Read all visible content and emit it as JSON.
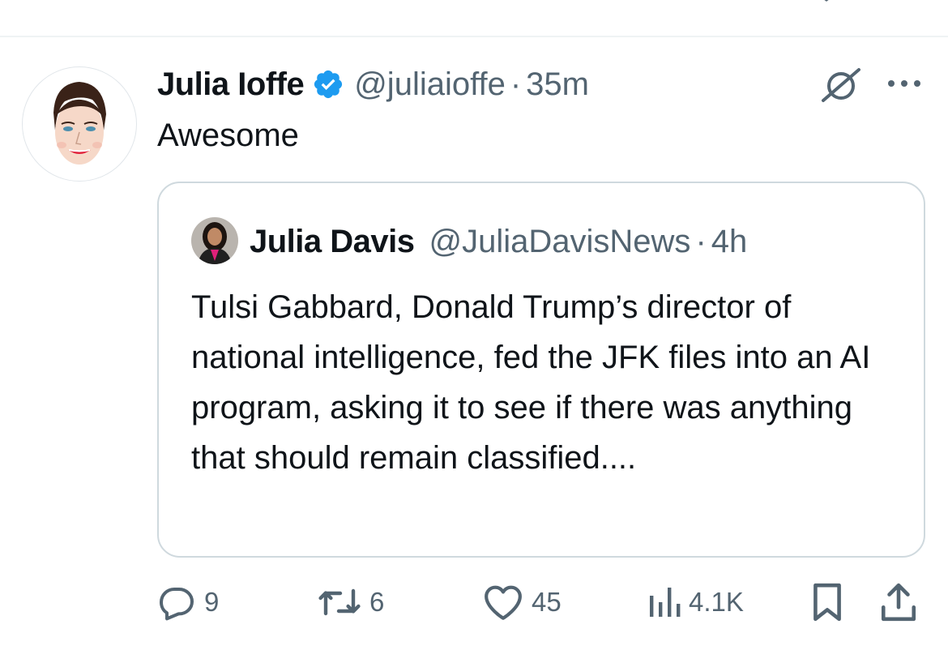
{
  "tweet": {
    "author": {
      "name": "Julia Ioffe",
      "handle": "@juliaioffe",
      "verified": true,
      "avatar_icon": "cartoon-portrait-avatar"
    },
    "separator": "·",
    "time": "35m",
    "text": "Awesome",
    "grok_icon": "grok-icon",
    "more_icon": "more-dots-icon",
    "quoted": {
      "author": {
        "name": "Julia Davis",
        "handle": "@JuliaDavisNews",
        "avatar_icon": "profile-photo-avatar"
      },
      "separator": "·",
      "time": "4h",
      "text": "Tulsi Gabbard, Donald Trump’s director of national intelligence, fed the JFK files into an AI program, asking it to see if there was anything that should remain classified...."
    },
    "actions": {
      "replies": "9",
      "reposts": "6",
      "likes": "45",
      "views": "4.1K",
      "icons": [
        "reply-icon",
        "repost-icon",
        "like-icon",
        "views-icon",
        "bookmark-icon",
        "share-icon"
      ]
    }
  },
  "colors": {
    "text_primary": "#0f1419",
    "text_secondary": "#536471",
    "verified_blue": "#1d9bf0",
    "border": "#cfd9de",
    "divider": "#eff3f4",
    "background": "#ffffff"
  }
}
